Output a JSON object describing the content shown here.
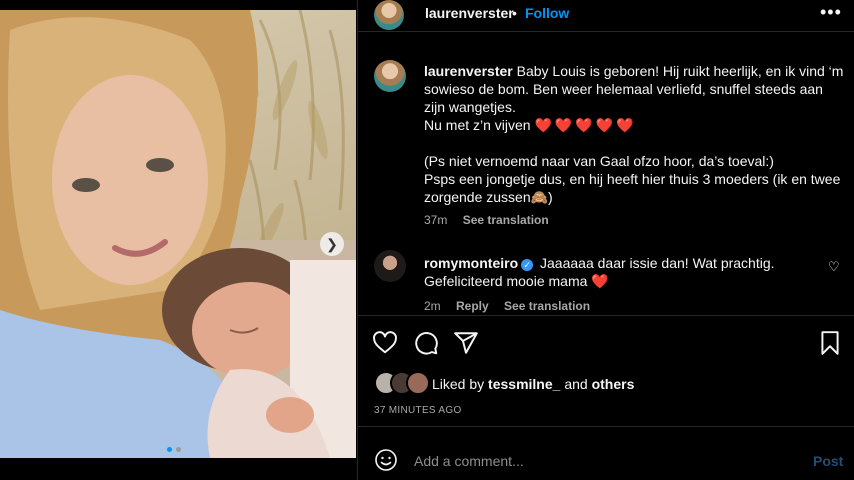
{
  "post": {
    "author": "laurenverster",
    "separator": "•",
    "follow_label": "Follow",
    "more_label": "•••",
    "carousel_dots": 2
  },
  "caption": {
    "username": "laurenverster",
    "line1": "Baby Louis is geboren! Hij ruikt heerlijk, en ik vind ‘m sowieso de bom. Ben weer helemaal verliefd, snuffel steeds aan zijn wangetjes.",
    "line2": "Nu met z’n vijven",
    "hearts": "❤️❤️❤️❤️❤️",
    "line3": "(Ps niet vernoemd naar van Gaal ofzo hoor, da’s toeval:)",
    "line4": "Psps een jongetje dus, en hij heeft hier thuis 3 moeders (ik en twee zorgende zussen🙈)",
    "time": "37m",
    "see_translation": "See translation"
  },
  "comment": {
    "username": "romymonteiro",
    "verified_mark": "✓",
    "text": "Jaaaaaa daar issie dan! Wat prachtig. Gefeliciteerd mooie mama",
    "heart": "❤️",
    "time": "2m",
    "reply": "Reply",
    "see_translation": "See translation"
  },
  "likes": {
    "prefix": "Liked by",
    "user": "tessmilne_",
    "conjunction": "and",
    "others": "others"
  },
  "timestamp": "37 MINUTES AGO",
  "add_comment": {
    "placeholder": "Add a comment...",
    "post_label": "Post"
  },
  "colors": {
    "accent": "#0095f6",
    "background": "#000000",
    "heart": "#ed1c24"
  }
}
